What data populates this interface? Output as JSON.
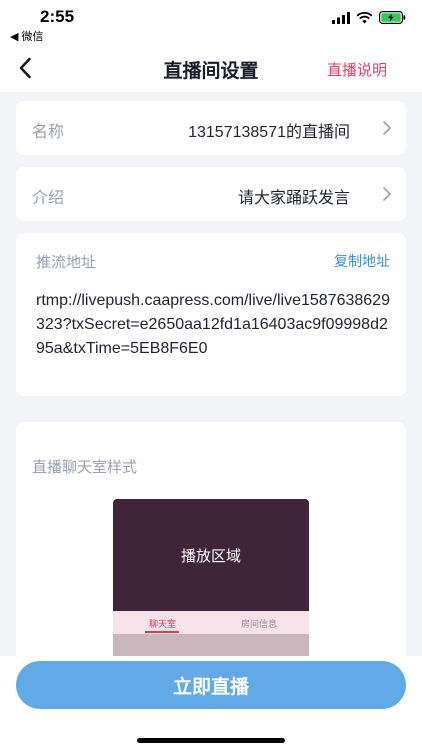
{
  "status_bar": {
    "time": "2:55",
    "back_app": "◀ 微信"
  },
  "nav": {
    "title": "直播间设置",
    "help_link": "直播说明"
  },
  "name_row": {
    "label": "名称",
    "value": "13157138571的直播间"
  },
  "intro_row": {
    "label": "介绍",
    "value": "请大家踊跃发言"
  },
  "push": {
    "label": "推流地址",
    "copy_label": "复制地址",
    "url": "rtmp://livepush.caapress.com/live/live1587638629323?txSecret=e2650aa12fd1a16403ac9f09998d295a&txTime=5EB8F6E0"
  },
  "chat_style": {
    "label": "直播聊天室样式",
    "preview_title": "播放区域",
    "tabs": [
      {
        "label": "聊天室"
      },
      {
        "label": "房间信息"
      }
    ]
  },
  "start_button": {
    "label": "立即直播"
  },
  "colors": {
    "accent_blue": "#62a9e8",
    "help_link": "#e2406a",
    "copy_link": "#3e8ed8",
    "preview_bg": "#40253a",
    "battery": "#34c759"
  }
}
